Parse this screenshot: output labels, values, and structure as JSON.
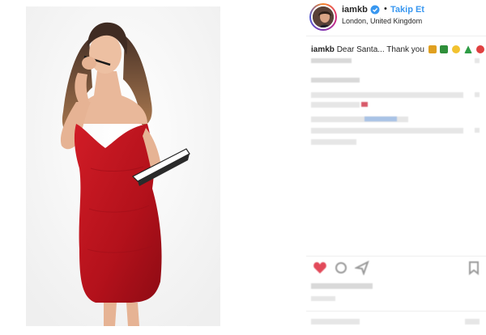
{
  "post": {
    "username": "iamkb",
    "separator": "•",
    "follow_label": "Takip Et",
    "location": "London, United Kingdom"
  },
  "caption": {
    "author": "iamkb",
    "text": "Dear Santa... Thank you",
    "emojis": [
      "gift-emoji",
      "holly-emoji",
      "laughing-emoji",
      "christmas-tree-emoji",
      "santa-emoji"
    ]
  },
  "colors": {
    "follow_blue": "#3897f0",
    "verified_blue": "#3897f0",
    "dress_red": "#c3151f"
  },
  "icons": [
    "verified-badge-icon",
    "heart-icon",
    "comment-icon",
    "share-icon",
    "bookmark-icon"
  ]
}
